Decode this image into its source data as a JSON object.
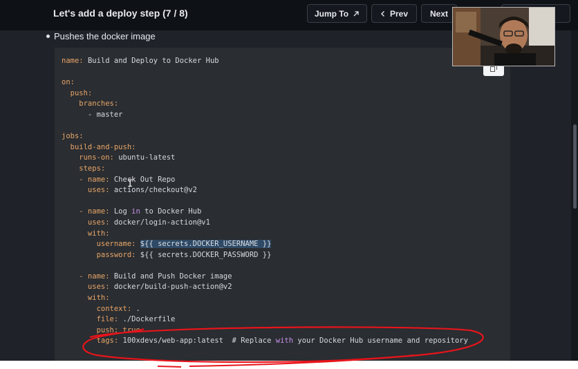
{
  "header": {
    "title": "Let's add a deploy step (7 / 8)",
    "jump_label": "Jump To",
    "prev_label": "Prev",
    "next_label": "Next"
  },
  "content": {
    "bullet_text": "Pushes the docker image"
  },
  "code_lines": [
    [
      {
        "t": "name: ",
        "c": "k"
      },
      {
        "t": "Build and Deploy to Docker Hub",
        "c": "s"
      }
    ],
    [],
    [
      {
        "t": "on:",
        "c": "k"
      }
    ],
    [
      {
        "t": "  push:",
        "c": "k"
      }
    ],
    [
      {
        "t": "    branches:",
        "c": "k"
      }
    ],
    [
      {
        "t": "      - master",
        "c": "s"
      }
    ],
    [],
    [
      {
        "t": "jobs:",
        "c": "k"
      }
    ],
    [
      {
        "t": "  build-and-push:",
        "c": "k"
      }
    ],
    [
      {
        "t": "    runs-on: ",
        "c": "k"
      },
      {
        "t": "ubuntu-latest",
        "c": "s"
      }
    ],
    [
      {
        "t": "    steps:",
        "c": "k"
      }
    ],
    [
      {
        "t": "    - name: ",
        "c": "k"
      },
      {
        "t": "Check Out Repo",
        "c": "s"
      }
    ],
    [
      {
        "t": "      uses: ",
        "c": "k"
      },
      {
        "t": "actions/checkout@v2",
        "c": "s"
      }
    ],
    [],
    [
      {
        "t": "    - name: ",
        "c": "k"
      },
      {
        "t": "Log ",
        "c": "s"
      },
      {
        "t": "in",
        "c": "kw"
      },
      {
        "t": " to Docker Hub",
        "c": "s"
      }
    ],
    [
      {
        "t": "      uses: ",
        "c": "k"
      },
      {
        "t": "docker/login-action@v1",
        "c": "s"
      }
    ],
    [
      {
        "t": "      with:",
        "c": "k"
      }
    ],
    [
      {
        "t": "        username: ",
        "c": "k"
      },
      {
        "t": "${{ secrets.DOCKER_USERNAME }}",
        "c": "sel"
      }
    ],
    [
      {
        "t": "        password: ",
        "c": "k"
      },
      {
        "t": "${{ secrets.DOCKER_PASSWORD }}",
        "c": "s"
      }
    ],
    [],
    [
      {
        "t": "    - name: ",
        "c": "k"
      },
      {
        "t": "Build and Push Docker image",
        "c": "s"
      }
    ],
    [
      {
        "t": "      uses: ",
        "c": "k"
      },
      {
        "t": "docker/build-push-action@v2",
        "c": "s"
      }
    ],
    [
      {
        "t": "      with:",
        "c": "k"
      }
    ],
    [
      {
        "t": "        context: ",
        "c": "k"
      },
      {
        "t": ".",
        "c": "s"
      }
    ],
    [
      {
        "t": "        file: ",
        "c": "k"
      },
      {
        "t": "./Dockerfile",
        "c": "s"
      }
    ],
    [
      {
        "t": "        push: ",
        "c": "k"
      },
      {
        "t": "true",
        "c": "bool"
      }
    ],
    [
      {
        "t": "        tags: ",
        "c": "k"
      },
      {
        "t": "100xdevs/web-app:latest  # Replace ",
        "c": "s"
      },
      {
        "t": "with",
        "c": "kw"
      },
      {
        "t": " your Docker Hub username and repository",
        "c": "s"
      }
    ]
  ],
  "colors": {
    "header_bg": "#0e1116",
    "content_bg": "#1f2329",
    "code_bg": "#2a2d31",
    "key_color": "#e8a569",
    "annotation_red": "#e8141b"
  },
  "icons": {
    "jump": "arrow-up-right-icon",
    "prev": "chevron-left-icon",
    "copy": "copy-icon"
  }
}
